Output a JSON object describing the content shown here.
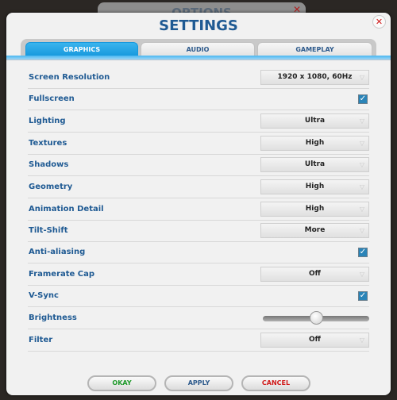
{
  "background_window": {
    "title": "OPTIONS"
  },
  "dialog": {
    "title": "SETTINGS",
    "close_icon": "close-x-icon"
  },
  "tabs": [
    {
      "label": "GRAPHICS",
      "active": true
    },
    {
      "label": "AUDIO",
      "active": false
    },
    {
      "label": "GAMEPLAY",
      "active": false
    }
  ],
  "settings": [
    {
      "label": "Screen Resolution",
      "type": "dropdown",
      "value": "1920 x 1080, 60Hz"
    },
    {
      "label": "Fullscreen",
      "type": "checkbox",
      "checked": true
    },
    {
      "label": "Lighting",
      "type": "dropdown",
      "value": "Ultra"
    },
    {
      "label": "Textures",
      "type": "dropdown",
      "value": "High"
    },
    {
      "label": "Shadows",
      "type": "dropdown",
      "value": "Ultra"
    },
    {
      "label": "Geometry",
      "type": "dropdown",
      "value": "High"
    },
    {
      "label": "Animation Detail",
      "type": "dropdown",
      "value": "High"
    },
    {
      "label": "Tilt-Shift",
      "type": "dropdown",
      "value": "More"
    },
    {
      "label": "Anti-aliasing",
      "type": "checkbox",
      "checked": true
    },
    {
      "label": "Framerate Cap",
      "type": "dropdown",
      "value": "Off"
    },
    {
      "label": "V-Sync",
      "type": "checkbox",
      "checked": true
    },
    {
      "label": "Brightness",
      "type": "slider",
      "value": 0.5
    },
    {
      "label": "Filter",
      "type": "dropdown",
      "value": "Off"
    }
  ],
  "buttons": {
    "okay": "OKAY",
    "apply": "APPLY",
    "cancel": "CANCEL"
  },
  "colors": {
    "okay": "#1e9a2a",
    "apply": "#2d5a8c",
    "cancel": "#d01818",
    "accent": "#1698dd"
  }
}
